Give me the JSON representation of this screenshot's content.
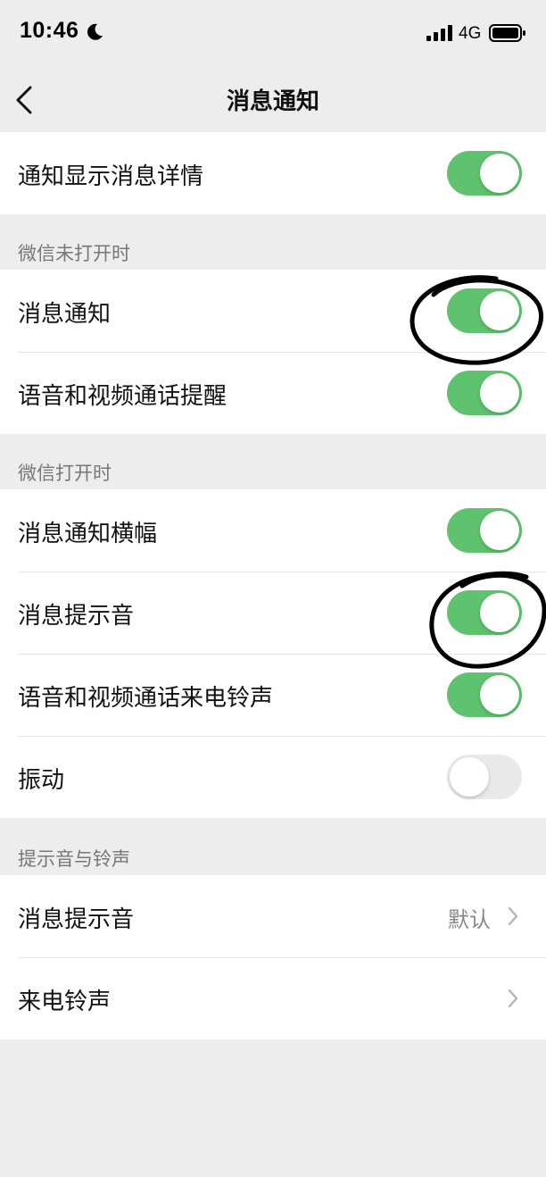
{
  "status_bar": {
    "time": "10:46",
    "network": "4G",
    "icons": [
      "moon-icon",
      "signal-icon",
      "battery-icon"
    ]
  },
  "nav": {
    "title": "消息通知",
    "back_icon": "chevron-left-icon"
  },
  "colors": {
    "toggle_on": "#5fc26f",
    "toggle_off": "#e9e9ea",
    "background": "#ededed",
    "annotation": "#000000"
  },
  "sections": {
    "top": {
      "items": [
        {
          "label": "通知显示消息详情",
          "toggle": true
        }
      ]
    },
    "closed": {
      "header": "微信未打开时",
      "items": [
        {
          "label": "消息通知",
          "toggle": true
        },
        {
          "label": "语音和视频通话提醒",
          "toggle": true
        }
      ]
    },
    "open": {
      "header": "微信打开时",
      "items": [
        {
          "label": "消息通知横幅",
          "toggle": true
        },
        {
          "label": "消息提示音",
          "toggle": true
        },
        {
          "label": "语音和视频通话来电铃声",
          "toggle": true
        },
        {
          "label": "振动",
          "toggle": false
        }
      ]
    },
    "sounds": {
      "header": "提示音与铃声",
      "items": [
        {
          "label": "消息提示音",
          "value": "默认"
        },
        {
          "label": "来电铃声",
          "value": ""
        }
      ]
    }
  }
}
